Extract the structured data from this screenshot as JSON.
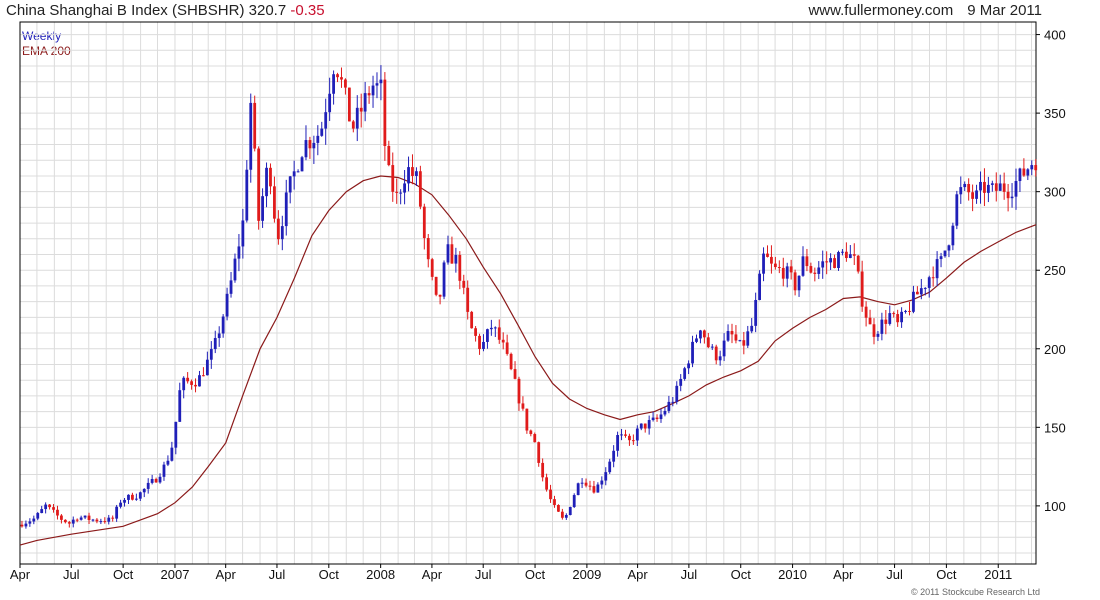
{
  "header": {
    "title": "China Shanghai B Index (SHBSHR)",
    "last": "320.7",
    "change": "-0.35",
    "site": "www.fullermoney.com",
    "date": "9 Mar 2011"
  },
  "legend": {
    "weekly": "Weekly",
    "ema": "EMA 200"
  },
  "copyright": "© 2011 Stockcube Research Ltd",
  "colors": {
    "up": "#1f1fb8",
    "down": "#e01b1b",
    "ema": "#8b1a1a",
    "grid": "#dcdcdc",
    "axis": "#000000"
  },
  "chart_data": {
    "type": "line",
    "subtype": "weekly candlestick with EMA 200",
    "ylim": [
      63,
      408
    ],
    "yticks": [
      100,
      150,
      200,
      250,
      300,
      350,
      400
    ],
    "x_range": [
      "2006-04-01",
      "2011-03-09"
    ],
    "xticks": [
      {
        "label": "Apr",
        "date": "2006-04-01"
      },
      {
        "label": "Jul",
        "date": "2006-07-01"
      },
      {
        "label": "Oct",
        "date": "2006-10-01"
      },
      {
        "label": "2007",
        "date": "2007-01-01"
      },
      {
        "label": "Apr",
        "date": "2007-04-01"
      },
      {
        "label": "Jul",
        "date": "2007-07-01"
      },
      {
        "label": "Oct",
        "date": "2007-10-01"
      },
      {
        "label": "2008",
        "date": "2008-01-01"
      },
      {
        "label": "Apr",
        "date": "2008-04-01"
      },
      {
        "label": "Jul",
        "date": "2008-07-01"
      },
      {
        "label": "Oct",
        "date": "2008-10-01"
      },
      {
        "label": "2009",
        "date": "2009-01-01"
      },
      {
        "label": "Apr",
        "date": "2009-04-01"
      },
      {
        "label": "Jul",
        "date": "2009-07-01"
      },
      {
        "label": "Oct",
        "date": "2009-10-01"
      },
      {
        "label": "2010",
        "date": "2010-01-01"
      },
      {
        "label": "Apr",
        "date": "2010-04-01"
      },
      {
        "label": "Jul",
        "date": "2010-07-01"
      },
      {
        "label": "Oct",
        "date": "2010-10-01"
      },
      {
        "label": "2011",
        "date": "2011-01-01"
      }
    ],
    "series": [
      {
        "name": "Weekly",
        "kind": "price",
        "points": [
          [
            "2006-04-01",
            88
          ],
          [
            "2006-05-01",
            92
          ],
          [
            "2006-05-20",
            100
          ],
          [
            "2006-06-15",
            92
          ],
          [
            "2006-07-01",
            89
          ],
          [
            "2006-07-15",
            93
          ],
          [
            "2006-08-15",
            91
          ],
          [
            "2006-09-15",
            91
          ],
          [
            "2006-10-01",
            104
          ],
          [
            "2006-11-01",
            107
          ],
          [
            "2006-12-01",
            117
          ],
          [
            "2006-12-20",
            127
          ],
          [
            "2007-01-01",
            140
          ],
          [
            "2007-01-15",
            178
          ],
          [
            "2007-02-15",
            180
          ],
          [
            "2007-03-15",
            200
          ],
          [
            "2007-04-10",
            235
          ],
          [
            "2007-05-05",
            280
          ],
          [
            "2007-05-20",
            362
          ],
          [
            "2007-06-01",
            280
          ],
          [
            "2007-06-20",
            320
          ],
          [
            "2007-07-05",
            270
          ],
          [
            "2007-07-25",
            300
          ],
          [
            "2007-08-20",
            330
          ],
          [
            "2007-09-20",
            338
          ],
          [
            "2007-10-15",
            385
          ],
          [
            "2007-10-25",
            372
          ],
          [
            "2007-11-15",
            340
          ],
          [
            "2007-12-01",
            352
          ],
          [
            "2007-12-20",
            368
          ],
          [
            "2008-01-05",
            365
          ],
          [
            "2008-01-15",
            315
          ],
          [
            "2008-02-01",
            295
          ],
          [
            "2008-02-20",
            315
          ],
          [
            "2008-03-10",
            307
          ],
          [
            "2008-03-25",
            260
          ],
          [
            "2008-04-15",
            225
          ],
          [
            "2008-05-01",
            262
          ],
          [
            "2008-05-20",
            255
          ],
          [
            "2008-06-10",
            215
          ],
          [
            "2008-07-01",
            200
          ],
          [
            "2008-07-20",
            215
          ],
          [
            "2008-08-10",
            200
          ],
          [
            "2008-09-01",
            175
          ],
          [
            "2008-09-20",
            150
          ],
          [
            "2008-10-05",
            140
          ],
          [
            "2008-10-20",
            115
          ],
          [
            "2008-11-05",
            100
          ],
          [
            "2008-11-25",
            90
          ],
          [
            "2008-12-10",
            105
          ],
          [
            "2008-12-25",
            118
          ],
          [
            "2009-01-20",
            110
          ],
          [
            "2009-02-10",
            125
          ],
          [
            "2009-03-01",
            145
          ],
          [
            "2009-03-20",
            140
          ],
          [
            "2009-04-10",
            150
          ],
          [
            "2009-05-10",
            155
          ],
          [
            "2009-06-10",
            170
          ],
          [
            "2009-07-10",
            200
          ],
          [
            "2009-07-25",
            215
          ],
          [
            "2009-08-10",
            200
          ],
          [
            "2009-08-25",
            195
          ],
          [
            "2009-09-15",
            210
          ],
          [
            "2009-10-05",
            200
          ],
          [
            "2009-10-25",
            215
          ],
          [
            "2009-11-15",
            260
          ],
          [
            "2009-12-01",
            250
          ],
          [
            "2009-12-20",
            250
          ],
          [
            "2010-01-10",
            240
          ],
          [
            "2010-01-25",
            258
          ],
          [
            "2010-02-10",
            248
          ],
          [
            "2010-03-01",
            255
          ],
          [
            "2010-03-25",
            257
          ],
          [
            "2010-04-10",
            262
          ],
          [
            "2010-04-25",
            255
          ],
          [
            "2010-05-10",
            228
          ],
          [
            "2010-05-25",
            210
          ],
          [
            "2010-06-10",
            215
          ],
          [
            "2010-06-25",
            222
          ],
          [
            "2010-07-10",
            215
          ],
          [
            "2010-07-25",
            223
          ],
          [
            "2010-08-10",
            233
          ],
          [
            "2010-08-25",
            240
          ],
          [
            "2010-09-10",
            250
          ],
          [
            "2010-09-25",
            255
          ],
          [
            "2010-10-10",
            272
          ],
          [
            "2010-10-25",
            300
          ],
          [
            "2010-11-10",
            300
          ],
          [
            "2010-11-25",
            295
          ],
          [
            "2010-12-10",
            303
          ],
          [
            "2010-12-25",
            300
          ],
          [
            "2011-01-10",
            303
          ],
          [
            "2011-01-25",
            302
          ],
          [
            "2011-02-10",
            308
          ],
          [
            "2011-02-25",
            315
          ],
          [
            "2011-03-09",
            320.7
          ]
        ]
      },
      {
        "name": "EMA 200",
        "kind": "line",
        "points": [
          [
            "2006-04-01",
            75
          ],
          [
            "2006-05-01",
            78
          ],
          [
            "2006-07-01",
            82
          ],
          [
            "2006-10-01",
            87
          ],
          [
            "2006-12-01",
            95
          ],
          [
            "2007-01-01",
            102
          ],
          [
            "2007-02-01",
            112
          ],
          [
            "2007-03-01",
            125
          ],
          [
            "2007-04-01",
            140
          ],
          [
            "2007-05-01",
            170
          ],
          [
            "2007-06-01",
            200
          ],
          [
            "2007-07-01",
            220
          ],
          [
            "2007-08-01",
            245
          ],
          [
            "2007-09-01",
            272
          ],
          [
            "2007-10-01",
            288
          ],
          [
            "2007-11-01",
            300
          ],
          [
            "2007-12-01",
            307
          ],
          [
            "2008-01-01",
            310
          ],
          [
            "2008-02-01",
            309
          ],
          [
            "2008-03-01",
            305
          ],
          [
            "2008-04-01",
            298
          ],
          [
            "2008-05-01",
            285
          ],
          [
            "2008-06-01",
            270
          ],
          [
            "2008-07-01",
            252
          ],
          [
            "2008-08-01",
            235
          ],
          [
            "2008-09-01",
            215
          ],
          [
            "2008-10-01",
            195
          ],
          [
            "2008-11-01",
            178
          ],
          [
            "2008-12-01",
            168
          ],
          [
            "2009-01-01",
            162
          ],
          [
            "2009-02-01",
            158
          ],
          [
            "2009-03-01",
            155
          ],
          [
            "2009-04-01",
            158
          ],
          [
            "2009-05-01",
            160
          ],
          [
            "2009-06-01",
            165
          ],
          [
            "2009-07-01",
            170
          ],
          [
            "2009-08-01",
            177
          ],
          [
            "2009-09-01",
            182
          ],
          [
            "2009-10-01",
            186
          ],
          [
            "2009-11-01",
            192
          ],
          [
            "2009-12-01",
            205
          ],
          [
            "2010-01-01",
            213
          ],
          [
            "2010-02-01",
            220
          ],
          [
            "2010-03-01",
            225
          ],
          [
            "2010-04-01",
            232
          ],
          [
            "2010-05-01",
            233
          ],
          [
            "2010-06-01",
            230
          ],
          [
            "2010-07-01",
            228
          ],
          [
            "2010-08-01",
            231
          ],
          [
            "2010-09-01",
            236
          ],
          [
            "2010-10-01",
            245
          ],
          [
            "2010-11-01",
            255
          ],
          [
            "2010-12-01",
            262
          ],
          [
            "2011-01-01",
            268
          ],
          [
            "2011-02-01",
            274
          ],
          [
            "2011-03-09",
            279
          ]
        ]
      }
    ]
  }
}
